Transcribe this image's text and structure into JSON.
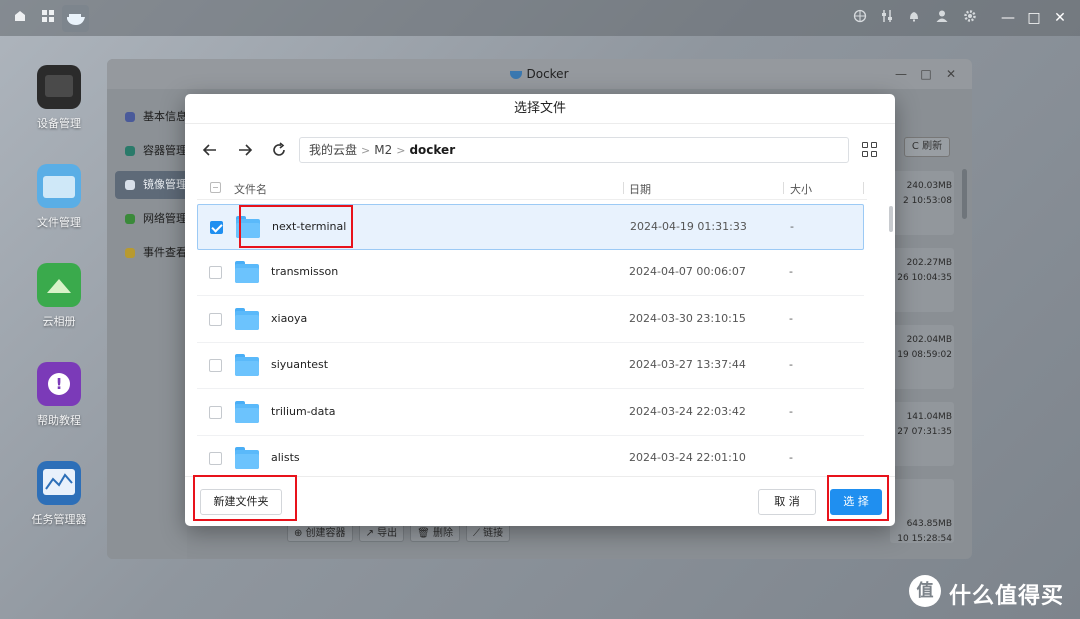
{
  "os_topbar": {
    "left_icons": [
      "home-icon",
      "apps-grid-icon",
      "docker-icon"
    ],
    "right_icons": [
      "network-icon",
      "sliders-icon",
      "bell-icon",
      "user-icon",
      "settings-gear-icon"
    ],
    "window_controls": {
      "min": "—",
      "max": "□",
      "close": "✕"
    }
  },
  "desktop": {
    "icons": [
      {
        "label": "设备管理",
        "icon": "device-manager-icon",
        "color": "#2b2b2b"
      },
      {
        "label": "文件管理",
        "icon": "file-manager-icon",
        "color": "#2f8ed8"
      },
      {
        "label": "云相册",
        "icon": "cloud-album-icon",
        "color": "#3aaa4c"
      },
      {
        "label": "帮助教程",
        "icon": "help-icon",
        "color": "#7b3ab8"
      },
      {
        "label": "任务管理器",
        "icon": "task-manager-icon",
        "color": "#2d6fb8"
      }
    ]
  },
  "docker_window": {
    "title": "Docker",
    "sidebar": [
      {
        "label": "基本信息",
        "dot": "#4a5a9a"
      },
      {
        "label": "容器管理",
        "dot": "#2a7a6a"
      },
      {
        "label": "镜像管理",
        "dot": "#d8e0ea",
        "active": true
      },
      {
        "label": "网络管理",
        "dot": "#3a8a3a"
      },
      {
        "label": "事件查看",
        "dot": "#b89a30"
      }
    ],
    "refresh_label": "C 刷新",
    "right_panel": [
      {
        "size": "240.03MB",
        "time": "2 10:53:08"
      },
      {
        "size": "202.27MB",
        "time": "26 10:04:35"
      },
      {
        "size": "202.04MB",
        "time": "19 08:59:02"
      },
      {
        "size": "141.04MB",
        "time": "27 07:31:35"
      },
      {
        "size": "643.85MB",
        "time": "10 15:28:54"
      }
    ],
    "bottom_actions": [
      "⊕ 创建容器",
      "↗ 导出",
      "🗑 删除",
      "⟋ 链接"
    ]
  },
  "modal": {
    "title": "选择文件",
    "breadcrumb": [
      "我的云盘",
      "M2",
      "docker"
    ],
    "columns": {
      "name": "文件名",
      "date": "日期",
      "size": "大小"
    },
    "rows": [
      {
        "name": "next-terminal",
        "date": "2024-04-19 01:31:33",
        "size": "-",
        "selected": true
      },
      {
        "name": "transmisson",
        "date": "2024-04-07 00:06:07",
        "size": "-",
        "selected": false
      },
      {
        "name": "xiaoya",
        "date": "2024-03-30 23:10:15",
        "size": "-",
        "selected": false
      },
      {
        "name": "siyuantest",
        "date": "2024-03-27 13:37:44",
        "size": "-",
        "selected": false
      },
      {
        "name": "trilium-data",
        "date": "2024-03-24 22:03:42",
        "size": "-",
        "selected": false
      },
      {
        "name": "alists",
        "date": "2024-03-24 22:01:10",
        "size": "-",
        "selected": false
      }
    ],
    "buttons": {
      "new_folder": "新建文件夹",
      "cancel": "取 消",
      "select": "选 择"
    }
  },
  "watermark": {
    "logo_char": "值",
    "text": "什么值得买"
  },
  "colors": {
    "accent": "#1f8ff0",
    "highlight": "#e8121b",
    "selected_row_bg": "#e8f2fd"
  }
}
